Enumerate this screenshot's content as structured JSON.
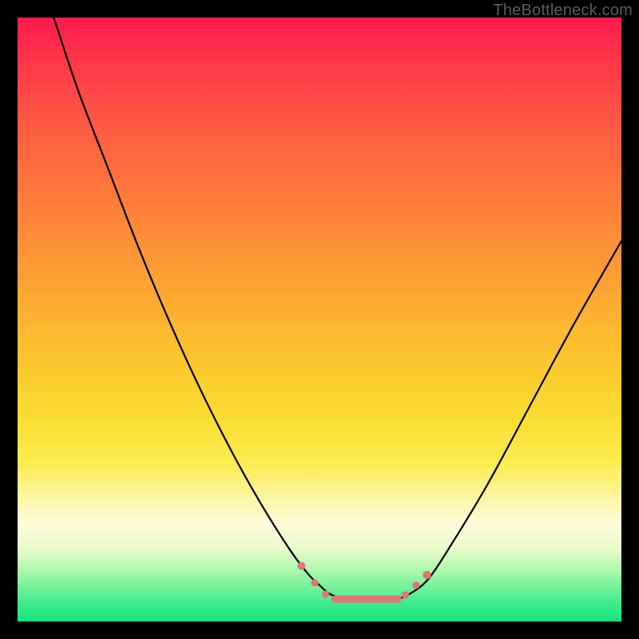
{
  "watermark": "TheBottleneck.com",
  "chart_data": {
    "type": "line",
    "title": "",
    "xlabel": "",
    "ylabel": "",
    "xlim": [
      0,
      100
    ],
    "ylim": [
      0,
      100
    ],
    "grid": false,
    "legend": false,
    "note": "No numeric axes/ticks shown; values are estimated from pixel positions within the plot area (0–100 range, y increases downward).",
    "background_gradient_stops": [
      {
        "pct": 0,
        "color": "#ff1a4d"
      },
      {
        "pct": 8,
        "color": "#ff3a4a"
      },
      {
        "pct": 18,
        "color": "#ff5a43"
      },
      {
        "pct": 30,
        "color": "#fe7b3b"
      },
      {
        "pct": 42,
        "color": "#fd9d34"
      },
      {
        "pct": 54,
        "color": "#fbbe2e"
      },
      {
        "pct": 66,
        "color": "#fadc2f"
      },
      {
        "pct": 74,
        "color": "#fbec52"
      },
      {
        "pct": 80,
        "color": "#fdf6aa"
      },
      {
        "pct": 84,
        "color": "#fefcdc"
      },
      {
        "pct": 88,
        "color": "#e9fcca"
      },
      {
        "pct": 91,
        "color": "#b6f9b1"
      },
      {
        "pct": 94,
        "color": "#7af39b"
      },
      {
        "pct": 97,
        "color": "#3eea8c"
      },
      {
        "pct": 100,
        "color": "#14e47f"
      }
    ],
    "series": [
      {
        "name": "bottleneck-curve",
        "color": "#000000",
        "stroke_width": 2.2,
        "x": [
          6,
          10,
          15,
          20,
          25,
          30,
          35,
          40,
          45,
          48,
          50,
          52,
          55,
          60,
          63,
          65,
          68,
          72,
          78,
          85,
          92,
          100
        ],
        "y": [
          0,
          12,
          25,
          38,
          50,
          61,
          71,
          80,
          88,
          92,
          94,
          95.6,
          96.2,
          96.4,
          96.2,
          95.4,
          93,
          87,
          77,
          64,
          51,
          37
        ]
      }
    ],
    "markers": [
      {
        "name": "left-upper-dot",
        "x": 47.0,
        "y": 90.8,
        "r": 5.0,
        "color": "#e27377"
      },
      {
        "name": "left-mid-dot",
        "x": 49.2,
        "y": 93.6,
        "r": 4.6,
        "color": "#e27377"
      },
      {
        "name": "left-lower-dot",
        "x": 51.0,
        "y": 95.5,
        "r": 4.6,
        "color": "#e27377"
      },
      {
        "name": "right-lower-dot",
        "x": 64.2,
        "y": 95.6,
        "r": 4.6,
        "color": "#e27377"
      },
      {
        "name": "right-mid-dot",
        "x": 66.0,
        "y": 94.0,
        "r": 4.6,
        "color": "#e27377"
      },
      {
        "name": "right-upper-dot",
        "x": 67.8,
        "y": 92.3,
        "r": 5.2,
        "color": "#e27377"
      }
    ],
    "flat_segment": {
      "x1": 52.5,
      "x2": 63.0,
      "y": 96.3,
      "thickness": 9,
      "color": "#e27377"
    }
  }
}
